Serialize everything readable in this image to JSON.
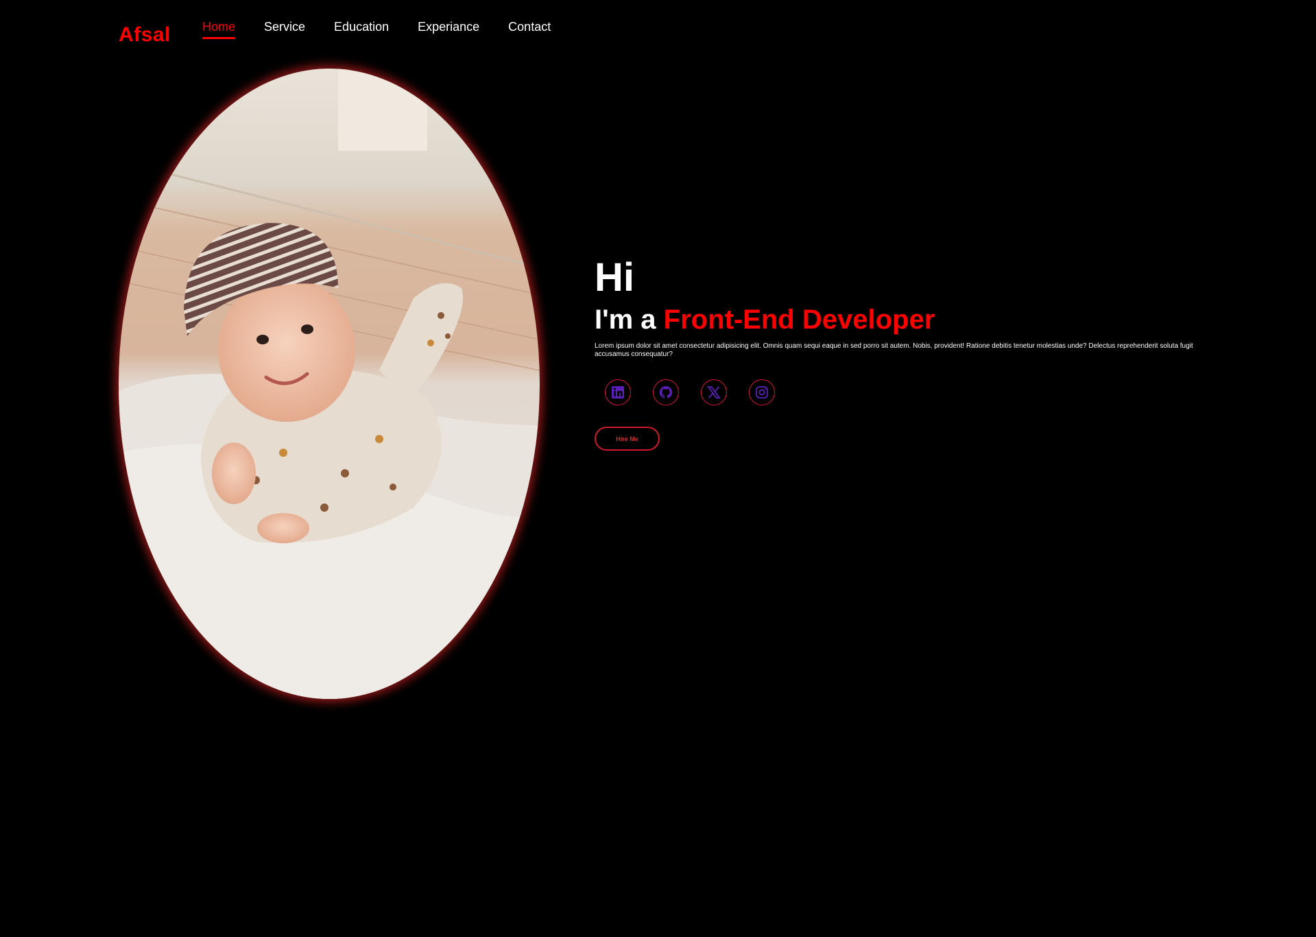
{
  "header": {
    "logo": "Afsal",
    "nav": [
      {
        "label": "Home",
        "active": true
      },
      {
        "label": "Service",
        "active": false
      },
      {
        "label": "Education",
        "active": false
      },
      {
        "label": "Experiance",
        "active": false
      },
      {
        "label": "Contact",
        "active": false
      }
    ]
  },
  "hero": {
    "greeting": "Hi",
    "intro_prefix": "I'm a ",
    "role": "Front-End Developer",
    "bio": "Lorem ipsum dolor sit amet consectetur adipisicing elit. Omnis quam sequi eaque in sed porro sit autem. Nobis, provident! Ratione debitis tenetur molestias unde? Delectus reprehenderit soluta fugit accusamus consequatur?",
    "hire_label": "Hire Me",
    "image": "baby-photo"
  },
  "socials": [
    {
      "icon": "linkedin-icon"
    },
    {
      "icon": "github-icon"
    },
    {
      "icon": "x-icon"
    },
    {
      "icon": "instagram-icon"
    }
  ],
  "colors": {
    "background": "#000000",
    "accent": "#ff0000",
    "text": "#ffffff",
    "icon": "#5b1fb8",
    "icon_border": "#e0103a"
  }
}
